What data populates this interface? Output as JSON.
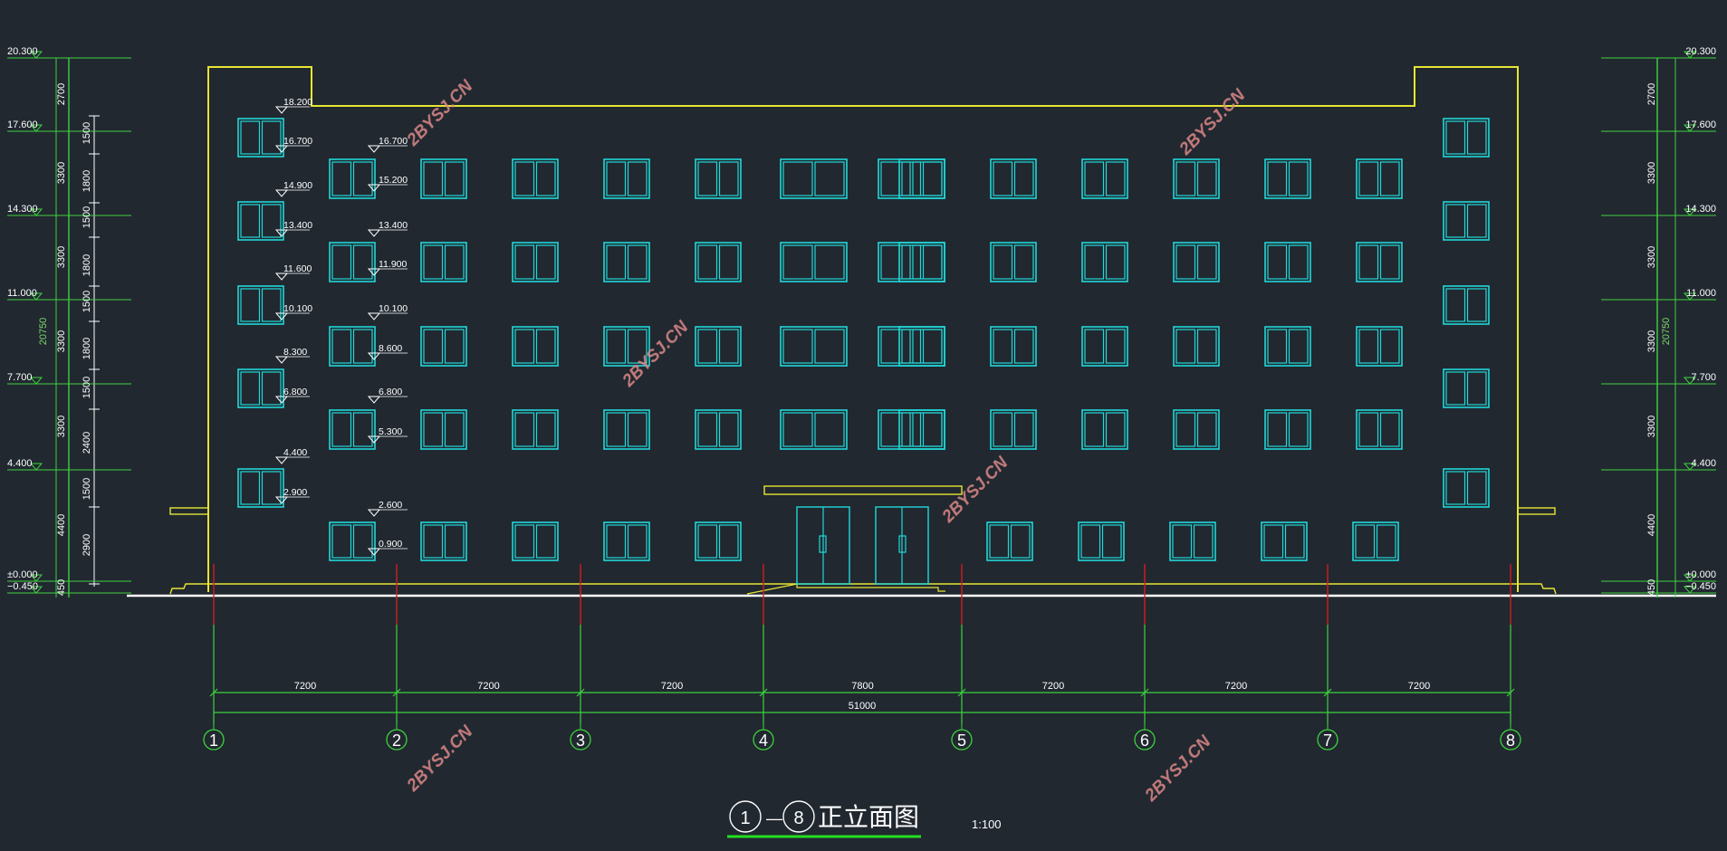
{
  "colors": {
    "background": "#212830",
    "outline": "#e6e632",
    "windows": "#20d8d8",
    "dimension": "#3ed23e",
    "axis_tick": "#d21e1e",
    "text": "#ffffff",
    "watermark": "#e08a8a"
  },
  "outer_levels": [
    "20.300",
    "17.600",
    "14.300",
    "11.000",
    "7.700",
    "4.400",
    "±0.000",
    "−0.450"
  ],
  "outer_dims": [
    "2700",
    "3300",
    "3300",
    "3300",
    "3300",
    "4400",
    "450"
  ],
  "total_height": "20750",
  "inner_dims": [
    "1500",
    "1800",
    "1500",
    "1800",
    "1500",
    "1800",
    "1500",
    "2400",
    "1500",
    "2900"
  ],
  "left_column_levels": [
    "18.200",
    "16.700",
    "14.900",
    "13.400",
    "11.600",
    "10.100",
    "8.300",
    "6.800",
    "4.400",
    "2.900"
  ],
  "bay_levels": [
    "16.700",
    "15.200",
    "13.400",
    "11.900",
    "10.100",
    "8.600",
    "6.800",
    "5.300",
    "2.600",
    "0.900"
  ],
  "axis_labels": [
    "1",
    "2",
    "3",
    "4",
    "5",
    "6",
    "7",
    "8"
  ],
  "bay_dims": [
    "7200",
    "7200",
    "7200",
    "7800",
    "7200",
    "7200",
    "7200"
  ],
  "overall_dim": "51000",
  "title": {
    "from": "1",
    "dash": "—",
    "to": "8",
    "name": "正立面图",
    "scale": "1:100"
  },
  "watermark_text": "2BYSJ.CN"
}
